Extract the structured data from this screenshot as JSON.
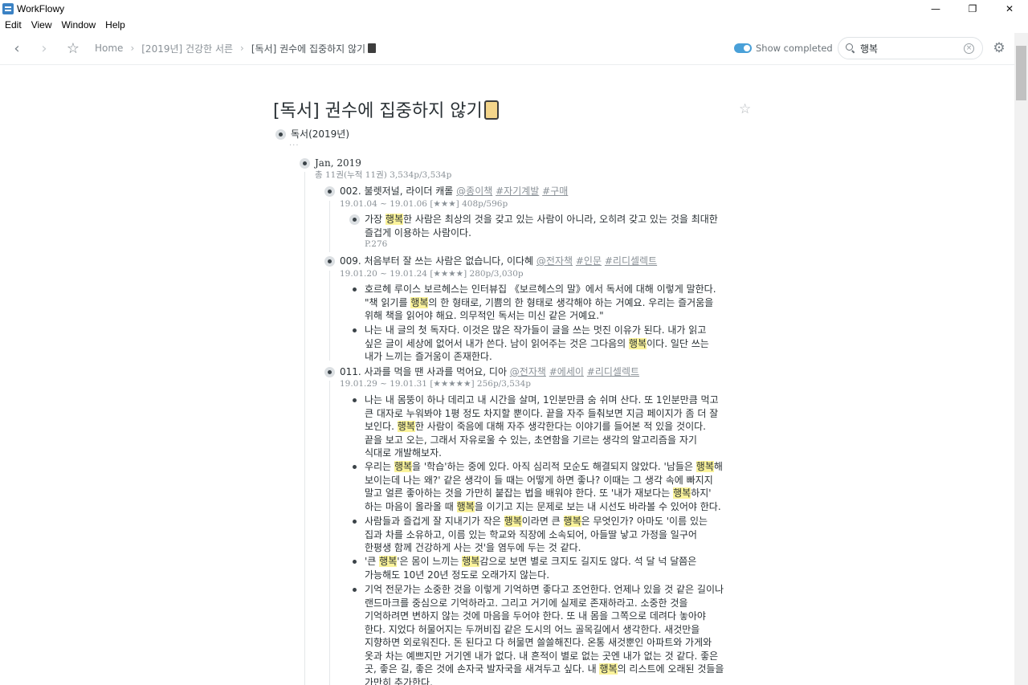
{
  "window": {
    "title": "WorkFlowy",
    "minimize": "—",
    "maximize": "❐",
    "close": "✕"
  },
  "menu": [
    "Edit",
    "View",
    "Window",
    "Help"
  ],
  "toolbar": {
    "back": "‹",
    "forward": "›",
    "star": "☆",
    "breadcrumb": [
      "Home",
      "[2019년] 건강한 서른",
      "[독서] 권수에 집중하지 않기"
    ],
    "crumb_sep": "›",
    "show_completed_label": "Show completed",
    "show_completed_on": true,
    "search_value": "행복",
    "search_clear": "×",
    "settings": "⚙"
  },
  "page": {
    "title": "[독서] 권수에 집중하지 않기",
    "star": "☆",
    "section": "독서(2019년)",
    "collapsed": "···",
    "month": {
      "label": "Jan, 2019",
      "note": "총 11권(누적 11권) 3,534p/3,534p"
    }
  },
  "books": [
    {
      "title_pre": "002. 불렛저널, 라이더 캐롤 ",
      "tags": [
        "@종이책",
        "#자기계발",
        "#구매"
      ],
      "note": "19.01.04 ~ 19.01.06 [★★★] 408p/596p"
    },
    {
      "title_pre": "009. 처음부터 잘 쓰는 사람은 없습니다, 이다혜 ",
      "tags": [
        "@전자책",
        "#인문",
        "#리디셀렉트"
      ],
      "note": "19.01.20 ~ 19.01.24  [★★★★] 280p/3,030p"
    },
    {
      "title_pre": "011. 사과를 먹을 땐 사과를 먹어요, 디아 ",
      "tags": [
        "@전자책",
        "#에세이",
        "#리디셀렉트"
      ],
      "note": "19.01.29 ~ 19.01.31 [★★★★★] 256p/3,534p"
    }
  ],
  "quotes": {
    "q1": {
      "pre": "가장 ",
      "hl": "행복",
      "post": "한 사람은 최상의 것을 갖고 있는 사람이 아니라, 오히려 갖고 있는 것을 최대한 즐겁게 이용하는 사람이다.",
      "note": "P.276"
    },
    "q2": {
      "pre": "호르헤 루이스 보르헤스는 인터뷰집 《보르헤스의 말》에서 독서에 대해 이렇게 말한다. \"책 읽기를 ",
      "hl": "행복",
      "post": "의 한 형태로, 기쁨의 한 형태로 생각해야 하는 거예요. 우리는 즐거움을 위해 책을 읽어야 해요. 의무적인 독서는 미신 같은 거예요.\""
    },
    "q3": {
      "pre": "나는 내 글의 첫 독자다. 이것은 많은 작가들이 글을 쓰는 멋진 이유가 된다. 내가 읽고 싶은 글이 세상에 없어서 내가 쓴다. 남이 읽어주는 것은 그다음의 ",
      "hl": "행복",
      "post": "이다. 일단 쓰는 내가 느끼는 즐거움이 존재한다."
    },
    "q4": {
      "pre": "나는 내 몸뚱이 하나 데리고 내 시간을 살며, 1인분만큼 숨 쉬며 산다. 또 1인분만큼 먹고 큰 대자로 누워봐야 1평 정도 차지할 뿐이다. 끝을 자주 들춰보면 지금 페이지가 좀 더 잘 보인다. ",
      "hl": "행복",
      "post": "한 사람이 죽음에 대해 자주 생각한다는 이야기를 들어본 적 있을 것이다. 끝을 보고 오는, 그래서 자유로울 수 있는, 초연함을 기르는 생각의 알고리즘을 자기 식대로 개발해보자."
    },
    "q5": {
      "p1": "우리는 ",
      "h1": "행복",
      "p2": "을 '학습'하는 중에 있다. 아직 심리적 모순도 해결되지 않았다. '남들은 ",
      "h2": "행복",
      "p3": "해 보이는데 나는 왜?' 같은 생각이 들 때는 어떻게 하면 좋나? 이때는 그 생각 속에 빠지지 말고 얼른 좋아하는 것을 가만히 붙잡는 법을 배워야 한다. 또 '내가 재보다는 ",
      "h3": "행복",
      "p4": "하지' 하는 마음이 올라올 때 ",
      "h4": "행복",
      "p5": "을 이기고 지는 문제로 보는 내 시선도 바라볼 수 있어야 한다."
    },
    "q6": {
      "p1": "사람들과 즐겁게 잘 지내기가 작은 ",
      "h1": "행복",
      "p2": "이라면 큰 ",
      "h2": "행복",
      "p3": "은 무엇인가? 아마도 '이름 있는 집과 차를 소유하고, 이름 있는 학교와 직장에 소속되어, 아들딸 낳고 가정을 일구어 한평생 함께 건강하게 사는 것'을 염두에 두는 것 같다."
    },
    "q7": {
      "p1": "'큰 ",
      "h1": "행복",
      "p2": "'은 몸이 느끼는 ",
      "h2": "행복",
      "p3": "감으로 보면 별로 크지도 길지도 않다. 석 달 넉 달쯤은 가능해도 10년 20년 정도로 오래가지 않는다."
    },
    "q8": {
      "pre": "기억 전문가는 소중한 것을 이렇게 기억하면 좋다고 조언한다. 언제나 있을 것 같은 길이나 랜드마크를 중심으로 기억하라고. 그리고 거기에 실제로 존재하라고. 소중한 것을 기억하려면 변하지 않는 것에 마음을 두어야 한다. 또 내 몸을 그쪽으로 데려다 놓아야 한다. 지었다 허물어지는 두꺼비집 같은 도시의 어느 골목길에서 생각한다. 새것만을 지향하면 외로워진다. 돈 된다고 다 허물면 쓸쓸해진다. 온통 새것뿐인 아파트와 가게와 옷과 차는 예쁘지만 거기엔 내가 없다. 내 흔적이 별로 없는 곳엔 내가 없는 것 같다. 좋은 곳, 좋은 길, 좋은 것에 손자국 발자국을 새겨두고 싶다. 내 ",
      "hl": "행복",
      "post": "의 리스트에 오래된 것들을 가만히 추가한다."
    }
  }
}
